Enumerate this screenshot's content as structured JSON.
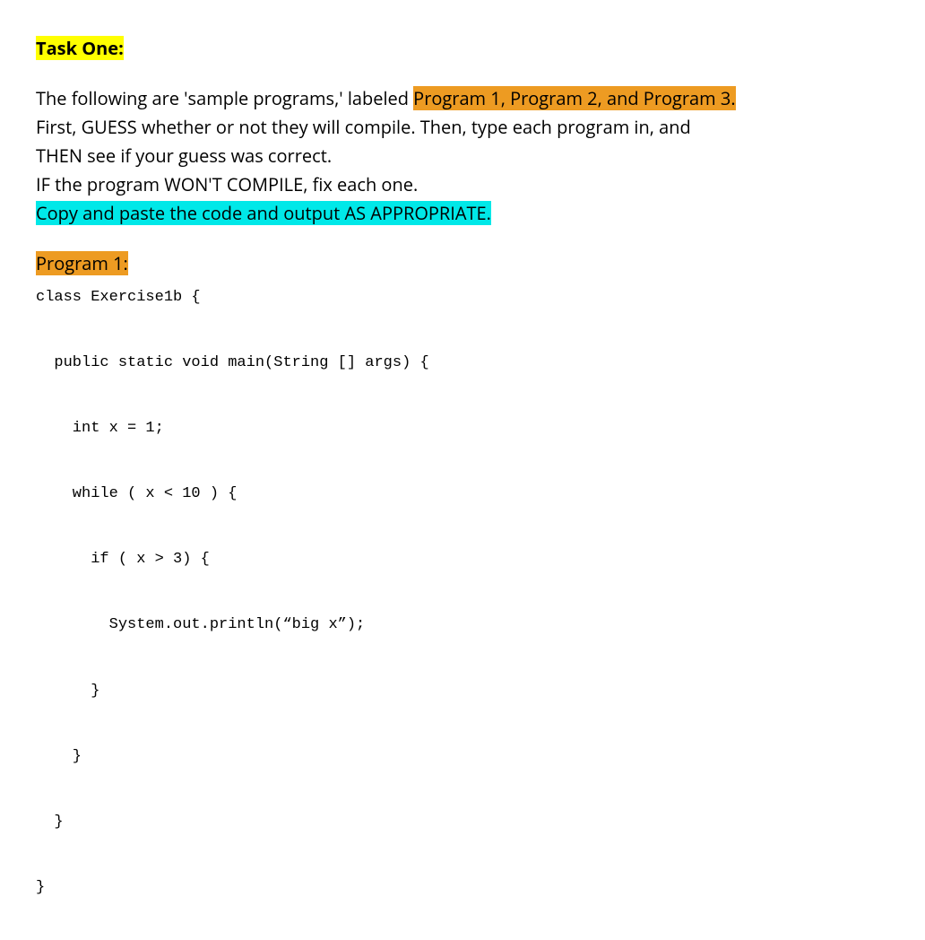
{
  "task_heading": "Task One:",
  "intro": {
    "line1_pre": "The following are 'sample programs,' labeled ",
    "line1_hl": "Program 1, Program 2, and Program 3.",
    "line2": "First, GUESS whether or not they will compile. Then, type each program in, and",
    "line3": "THEN see if your guess was correct.",
    "line4": "IF the program WON'T COMPILE, fix each one.",
    "line5_hl": "Copy and paste the code and output AS APPROPRIATE."
  },
  "program1": {
    "label": "Program 1:",
    "code": "class Exercise1b {\n\n  public static void main(String [] args) {\n\n    int x = 1;\n\n    while ( x < 10 ) {\n\n      if ( x > 3) {\n\n        System.out.println(“big x”);\n\n      }\n\n    }\n\n  }\n\n}"
  }
}
